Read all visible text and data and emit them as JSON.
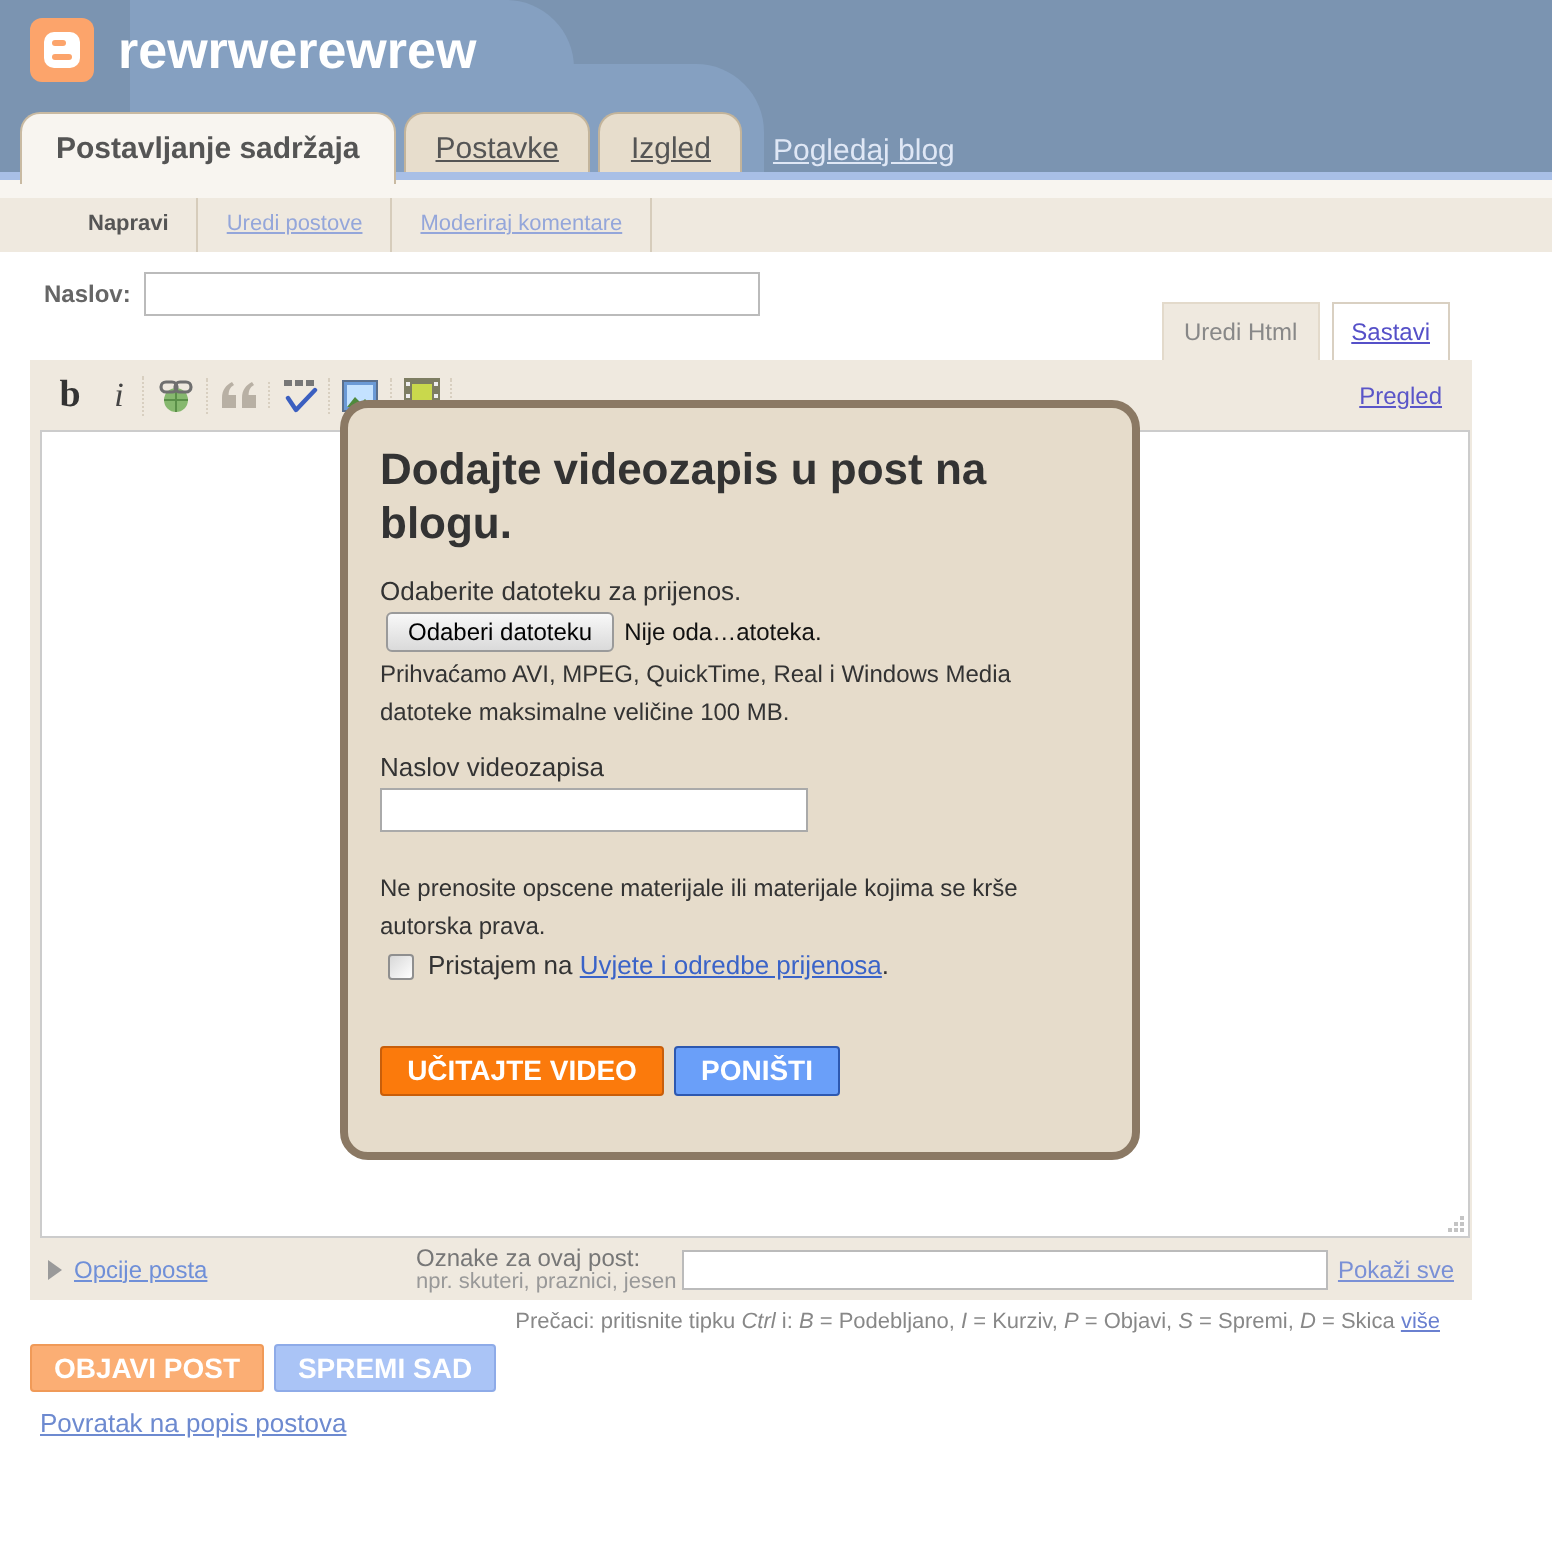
{
  "header": {
    "blog_title": "rewrwerewrew"
  },
  "tabs": [
    {
      "label": "Postavljanje sadržaja",
      "selected": true
    },
    {
      "label": "Postavke",
      "selected": false
    },
    {
      "label": "Izgled",
      "selected": false
    }
  ],
  "view_blog_link": "Pogledaj blog",
  "subnav": [
    {
      "label": "Napravi",
      "selected": true
    },
    {
      "label": "Uredi postove",
      "selected": false
    },
    {
      "label": "Moderiraj komentare",
      "selected": false
    }
  ],
  "post_title": {
    "label": "Naslov:"
  },
  "editor_modes": [
    {
      "label": "Uredi Html",
      "selected": true
    },
    {
      "label": "Sastavi",
      "selected": false
    }
  ],
  "toolbar": [
    {
      "kind": "bold",
      "label": "b"
    },
    {
      "kind": "italic",
      "label": "i"
    },
    {
      "kind": "link"
    },
    {
      "kind": "quote"
    },
    {
      "kind": "spellcheck"
    },
    {
      "kind": "image"
    },
    {
      "kind": "video"
    }
  ],
  "preview_link": "Pregled",
  "post_options": {
    "label": "Opcije posta",
    "expanded": false
  },
  "post_labels": {
    "label": "Oznake za ovaj post:",
    "hint": "npr. skuteri, praznici, jesen",
    "show_all_link": "Pokaži sve"
  },
  "shortcuts": {
    "text": "Prečaci: pritisnite tipku *Ctrl* i: *B* = Podebljano, *I* = Kurziv, *P* = Objavi, *S* = Spremi, *D* = Skica",
    "more_link": "više"
  },
  "actions": [
    {
      "kind": "publish",
      "label": "OBJAVI POST"
    },
    {
      "kind": "save",
      "label": "SPREMI SAD"
    }
  ],
  "back_link": "Povratak na popis postova",
  "dialog": {
    "title": "Dodajte videozapis u post na blogu.",
    "file_prompt": "Odaberite datoteku za prijenos.",
    "file_button": "Odaberi datoteku",
    "file_status": "Nije oda…atoteka.",
    "accepted_formats": "Prihvaćamo AVI, MPEG, QuickTime, Real i Windows Media datoteke maksimalne veličine 100 MB.",
    "video_title_label": "Naslov videozapisa",
    "warning": "Ne prenosite opscene materijale ili materijale kojima se krše autorska prava.",
    "agree": {
      "checked": false,
      "text_before": "Pristajem na",
      "link": "Uvjete i odredbe prijenosa",
      "text_after": "."
    },
    "buttons": [
      {
        "kind": "upload",
        "label": "UČITAJTE VIDEO"
      },
      {
        "kind": "cancel",
        "label": "PONIŠTI"
      }
    ]
  }
}
